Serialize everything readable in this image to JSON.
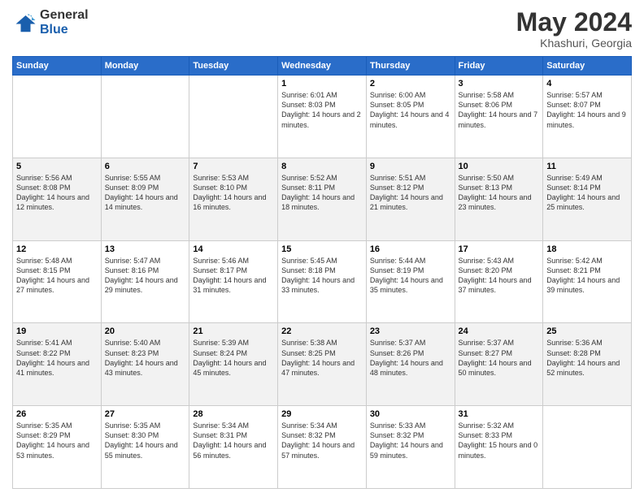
{
  "header": {
    "logo_general": "General",
    "logo_blue": "Blue",
    "month_year": "May 2024",
    "location": "Khashuri, Georgia"
  },
  "days_of_week": [
    "Sunday",
    "Monday",
    "Tuesday",
    "Wednesday",
    "Thursday",
    "Friday",
    "Saturday"
  ],
  "weeks": [
    [
      {
        "day": "",
        "sunrise": "",
        "sunset": "",
        "daylight": ""
      },
      {
        "day": "",
        "sunrise": "",
        "sunset": "",
        "daylight": ""
      },
      {
        "day": "",
        "sunrise": "",
        "sunset": "",
        "daylight": ""
      },
      {
        "day": "1",
        "sunrise": "6:01 AM",
        "sunset": "8:03 PM",
        "daylight": "14 hours and 2 minutes."
      },
      {
        "day": "2",
        "sunrise": "6:00 AM",
        "sunset": "8:05 PM",
        "daylight": "14 hours and 4 minutes."
      },
      {
        "day": "3",
        "sunrise": "5:58 AM",
        "sunset": "8:06 PM",
        "daylight": "14 hours and 7 minutes."
      },
      {
        "day": "4",
        "sunrise": "5:57 AM",
        "sunset": "8:07 PM",
        "daylight": "14 hours and 9 minutes."
      }
    ],
    [
      {
        "day": "5",
        "sunrise": "5:56 AM",
        "sunset": "8:08 PM",
        "daylight": "14 hours and 12 minutes."
      },
      {
        "day": "6",
        "sunrise": "5:55 AM",
        "sunset": "8:09 PM",
        "daylight": "14 hours and 14 minutes."
      },
      {
        "day": "7",
        "sunrise": "5:53 AM",
        "sunset": "8:10 PM",
        "daylight": "14 hours and 16 minutes."
      },
      {
        "day": "8",
        "sunrise": "5:52 AM",
        "sunset": "8:11 PM",
        "daylight": "14 hours and 18 minutes."
      },
      {
        "day": "9",
        "sunrise": "5:51 AM",
        "sunset": "8:12 PM",
        "daylight": "14 hours and 21 minutes."
      },
      {
        "day": "10",
        "sunrise": "5:50 AM",
        "sunset": "8:13 PM",
        "daylight": "14 hours and 23 minutes."
      },
      {
        "day": "11",
        "sunrise": "5:49 AM",
        "sunset": "8:14 PM",
        "daylight": "14 hours and 25 minutes."
      }
    ],
    [
      {
        "day": "12",
        "sunrise": "5:48 AM",
        "sunset": "8:15 PM",
        "daylight": "14 hours and 27 minutes."
      },
      {
        "day": "13",
        "sunrise": "5:47 AM",
        "sunset": "8:16 PM",
        "daylight": "14 hours and 29 minutes."
      },
      {
        "day": "14",
        "sunrise": "5:46 AM",
        "sunset": "8:17 PM",
        "daylight": "14 hours and 31 minutes."
      },
      {
        "day": "15",
        "sunrise": "5:45 AM",
        "sunset": "8:18 PM",
        "daylight": "14 hours and 33 minutes."
      },
      {
        "day": "16",
        "sunrise": "5:44 AM",
        "sunset": "8:19 PM",
        "daylight": "14 hours and 35 minutes."
      },
      {
        "day": "17",
        "sunrise": "5:43 AM",
        "sunset": "8:20 PM",
        "daylight": "14 hours and 37 minutes."
      },
      {
        "day": "18",
        "sunrise": "5:42 AM",
        "sunset": "8:21 PM",
        "daylight": "14 hours and 39 minutes."
      }
    ],
    [
      {
        "day": "19",
        "sunrise": "5:41 AM",
        "sunset": "8:22 PM",
        "daylight": "14 hours and 41 minutes."
      },
      {
        "day": "20",
        "sunrise": "5:40 AM",
        "sunset": "8:23 PM",
        "daylight": "14 hours and 43 minutes."
      },
      {
        "day": "21",
        "sunrise": "5:39 AM",
        "sunset": "8:24 PM",
        "daylight": "14 hours and 45 minutes."
      },
      {
        "day": "22",
        "sunrise": "5:38 AM",
        "sunset": "8:25 PM",
        "daylight": "14 hours and 47 minutes."
      },
      {
        "day": "23",
        "sunrise": "5:37 AM",
        "sunset": "8:26 PM",
        "daylight": "14 hours and 48 minutes."
      },
      {
        "day": "24",
        "sunrise": "5:37 AM",
        "sunset": "8:27 PM",
        "daylight": "14 hours and 50 minutes."
      },
      {
        "day": "25",
        "sunrise": "5:36 AM",
        "sunset": "8:28 PM",
        "daylight": "14 hours and 52 minutes."
      }
    ],
    [
      {
        "day": "26",
        "sunrise": "5:35 AM",
        "sunset": "8:29 PM",
        "daylight": "14 hours and 53 minutes."
      },
      {
        "day": "27",
        "sunrise": "5:35 AM",
        "sunset": "8:30 PM",
        "daylight": "14 hours and 55 minutes."
      },
      {
        "day": "28",
        "sunrise": "5:34 AM",
        "sunset": "8:31 PM",
        "daylight": "14 hours and 56 minutes."
      },
      {
        "day": "29",
        "sunrise": "5:34 AM",
        "sunset": "8:32 PM",
        "daylight": "14 hours and 57 minutes."
      },
      {
        "day": "30",
        "sunrise": "5:33 AM",
        "sunset": "8:32 PM",
        "daylight": "14 hours and 59 minutes."
      },
      {
        "day": "31",
        "sunrise": "5:32 AM",
        "sunset": "8:33 PM",
        "daylight": "15 hours and 0 minutes."
      },
      {
        "day": "",
        "sunrise": "",
        "sunset": "",
        "daylight": ""
      }
    ]
  ],
  "labels": {
    "sunrise": "Sunrise:",
    "sunset": "Sunset:",
    "daylight": "Daylight:"
  }
}
